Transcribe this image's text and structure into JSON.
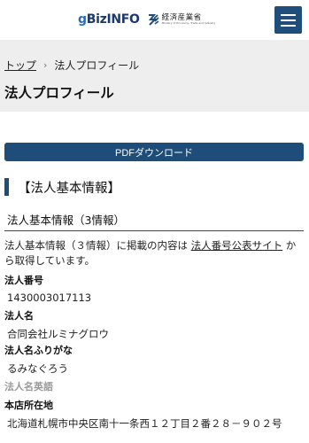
{
  "header": {
    "logo_text_g": "g",
    "logo_text_rest": "BizINFO",
    "meti_name": "経済産業省",
    "meti_en": "Ministry of Economy, Trade and Industry",
    "menu_icon": "hamburger-menu-icon"
  },
  "breadcrumb": {
    "home": "トップ",
    "separator": "›",
    "current": "法人プロフィール"
  },
  "page_title": "法人プロフィール",
  "pdf_button": "PDFダウンロード",
  "section_title": "【法人基本情報】",
  "tab_title": "法人基本情報（3情報）",
  "description": {
    "before": "法人基本情報（３情報）に掲載の内容は ",
    "link": "法人番号公表サイト",
    "after": " から取得しています。"
  },
  "fields": {
    "corp_number_label": "法人番号",
    "corp_number_value": "1430003017113",
    "corp_name_label": "法人名",
    "corp_name_value": "合同会社ルミナグロウ",
    "corp_kana_label": "法人名ふりがな",
    "corp_kana_value": "るみなぐろう",
    "corp_en_label": "法人名英語",
    "address_label": "本店所在地",
    "address_value": "北海道札幌市中央区南十一条西１２丁目２番２８－９０２号"
  },
  "colors": {
    "brand_navy": "#1f4d7a",
    "crumb_bg": "#eeeeee"
  }
}
